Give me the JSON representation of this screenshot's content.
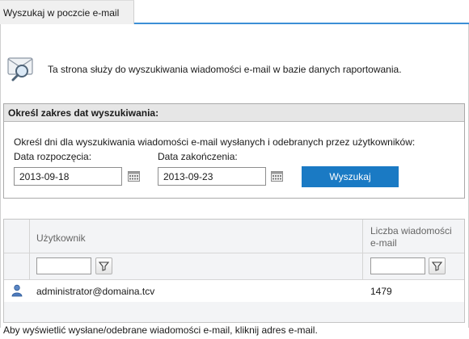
{
  "tab": {
    "label": "Wyszukaj w poczcie e-mail"
  },
  "intro": {
    "text": "Ta strona służy do wyszukiwania wiadomości e-mail w bazie danych raportowania.",
    "icon": "envelope-magnifier-icon"
  },
  "date_range": {
    "title": "Określ zakres dat wyszukiwania:",
    "description": "Określ dni dla wyszukiwania wiadomości e-mail wysłanych i odebranych przez użytkowników:",
    "start_label": "Data rozpoczęcia:",
    "start_value": "2013-09-18",
    "end_label": "Data zakończenia:",
    "end_value": "2013-09-23",
    "search_button": "Wyszukaj"
  },
  "grid": {
    "columns": [
      "Użytkownik",
      "Liczba wiadomości e-mail"
    ],
    "column_count_line1": "Liczba wiadomości",
    "column_count_line2": "e-mail",
    "rows": [
      {
        "user": "administrator@domaina.tcv",
        "count": "1479"
      }
    ]
  },
  "footer": {
    "text": "Aby wyświetlić wysłane/odebrane wiadomości e-mail, kliknij adres e-mail."
  },
  "colors": {
    "accent": "#1a7ac4",
    "tab_underline": "#3c8fd6",
    "header_bg": "#e6e6e6"
  }
}
